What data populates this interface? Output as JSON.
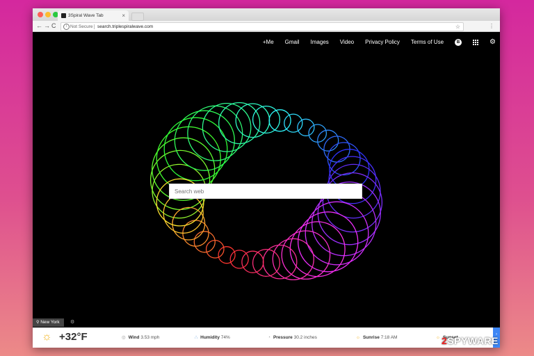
{
  "browser": {
    "tab_title": "3Spiral Wave Tab",
    "tab_close": "×",
    "security_label": "Not Secure",
    "url": "search.triplespiralwave.com",
    "star_glyph": "☆",
    "menu_glyph": "⋮",
    "nav": {
      "back": "←",
      "forward": "→",
      "reload": "C"
    }
  },
  "topnav": {
    "links": [
      "+Me",
      "Gmail",
      "Images",
      "Video",
      "Privacy Policy",
      "Terms of Use"
    ],
    "avatar_letter": "B",
    "icons": [
      "apps-icon",
      "gear-icon"
    ]
  },
  "search": {
    "placeholder": "Search web"
  },
  "location": {
    "city": "New York",
    "pin_glyph": "⚲",
    "settings_glyph": "⚙"
  },
  "weather": {
    "sun_glyph": "☼",
    "temperature": "+32°F",
    "items": [
      {
        "label": "Wind",
        "value": "3.53 mph",
        "icon": "wind-icon",
        "glyph": "◎"
      },
      {
        "label": "Humidity",
        "value": "74%",
        "icon": "humidity-icon",
        "glyph": "∴"
      },
      {
        "label": "Pressure",
        "value": "30.2 inches",
        "icon": "pressure-icon",
        "glyph": "◔"
      },
      {
        "label": "Sunrise",
        "value": "7:18 AM",
        "icon": "sunrise-icon",
        "glyph": "☼"
      },
      {
        "label": "Sunset",
        "value": "",
        "icon": "sunset-icon",
        "glyph": "☼"
      }
    ],
    "side_tab_glyph": "›"
  },
  "watermark": {
    "prefix": "2",
    "text": "SPYWARE"
  },
  "colors": {
    "accent": "#3d86f5",
    "background_gradient_top": "#d4289e",
    "background_gradient_bottom": "#ec8a88"
  }
}
